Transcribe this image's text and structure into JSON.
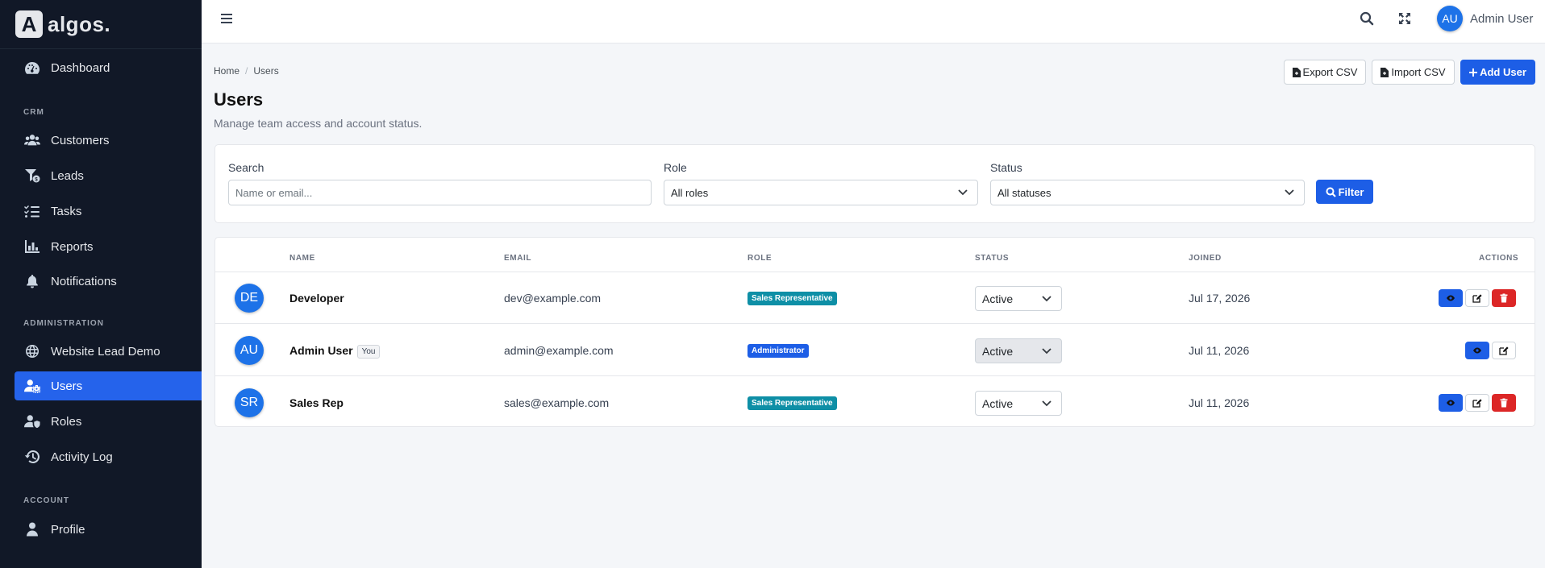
{
  "brand": {
    "logo_letter": "A",
    "name": "algos."
  },
  "sidebar": {
    "dashboard": "Dashboard",
    "section_crm": "CRM",
    "customers": "Customers",
    "leads": "Leads",
    "tasks": "Tasks",
    "reports": "Reports",
    "notifications": "Notifications",
    "section_admin": "ADMINISTRATION",
    "website_lead_demo": "Website Lead Demo",
    "users": "Users",
    "roles": "Roles",
    "activity_log": "Activity Log",
    "section_account": "ACCOUNT",
    "profile": "Profile",
    "active_item": "Users"
  },
  "topbar": {
    "avatar_initials": "AU",
    "user_name": "Admin User"
  },
  "breadcrumb": {
    "home": "Home",
    "sep": "/",
    "current": "Users"
  },
  "page": {
    "title": "Users",
    "subtitle": "Manage team access and account status."
  },
  "actions": {
    "export": "Export CSV",
    "import": "Import CSV",
    "add": "Add User"
  },
  "filters": {
    "search_label": "Search",
    "search_placeholder": "Name or email...",
    "role_label": "Role",
    "role_value": "All roles",
    "status_label": "Status",
    "status_value": "All statuses",
    "filter_button": "Filter"
  },
  "table": {
    "headers": {
      "name": "NAME",
      "email": "EMAIL",
      "role": "ROLE",
      "status": "STATUS",
      "joined": "JOINED",
      "actions": "ACTIONS"
    },
    "rows": [
      {
        "initials": "DE",
        "name": "Developer",
        "you": "",
        "email": "dev@example.com",
        "role": "Sales Representative",
        "role_color": "#0e8fa6",
        "status": "Active",
        "joined": "Jul 17, 2026"
      },
      {
        "initials": "AU",
        "name": "Admin User",
        "you": "You",
        "email": "admin@example.com",
        "role": "Administrator",
        "role_color": "#1d5ee6",
        "status": "Active",
        "joined": "Jul 11, 2026"
      },
      {
        "initials": "SR",
        "name": "Sales Rep",
        "you": "",
        "email": "sales@example.com",
        "role": "Sales Representative",
        "role_color": "#0e8fa6",
        "status": "Active",
        "joined": "Jul 11, 2026"
      }
    ]
  },
  "colors": {
    "sidebar_bg": "#111827",
    "accent": "#2563eb",
    "danger": "#dc2626",
    "info": "#0e8fa6"
  }
}
